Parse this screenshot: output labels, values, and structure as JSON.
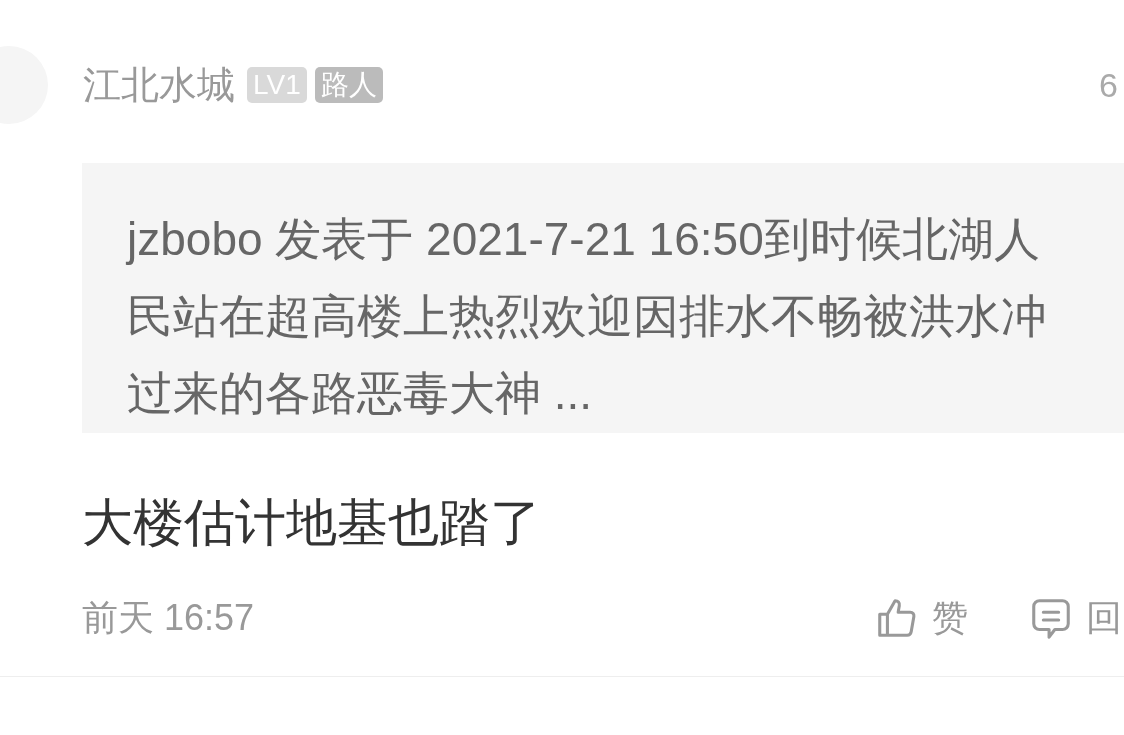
{
  "author": {
    "name": "江北水城",
    "level_badge": "LV1",
    "role_badge": "路人"
  },
  "floor": "6",
  "quote": "jzbobo 发表于 2021-7-21 16:50到时候北湖人民站在超高楼上热烈欢迎因排水不畅被洪水冲过来的各路恶毒大神 ...",
  "comment": "大楼估计地基也踏了",
  "time": "前天 16:57",
  "actions": [
    {
      "kind": "like",
      "label": "赞"
    },
    {
      "kind": "reply",
      "label": "回"
    }
  ]
}
